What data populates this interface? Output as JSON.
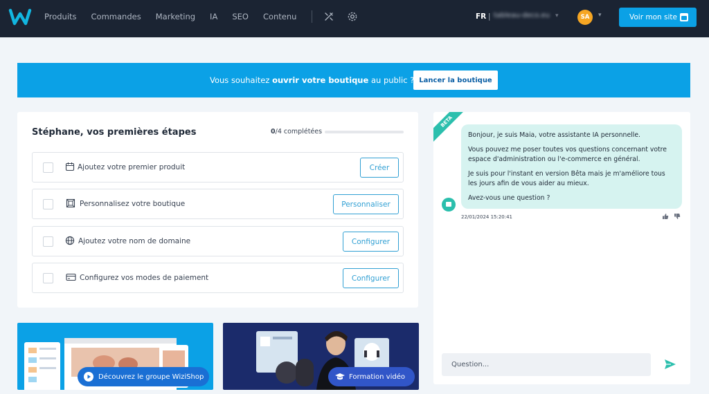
{
  "header": {
    "nav": [
      "Produits",
      "Commandes",
      "Marketing",
      "IA",
      "SEO",
      "Contenu"
    ],
    "tools_icon": "tools-icon",
    "settings_icon": "gear-icon",
    "language": "FR",
    "site_name": "tableau-deco.eu",
    "avatar_initials": "SA",
    "visit_button": "Voir mon site"
  },
  "banner": {
    "text_before": "Vous souhaitez ",
    "text_bold": "ouvrir votre boutique",
    "text_after": " au public ?",
    "button": "Lancer la boutique"
  },
  "steps": {
    "title": "Stéphane, vos premières étapes",
    "completed": "0",
    "total_label": "/4 complétées",
    "progress_fraction": 0,
    "items": [
      {
        "label": "Ajoutez votre premier produit",
        "button": "Créer",
        "icon": "calendar-box-icon"
      },
      {
        "label": "Personnalisez votre boutique",
        "button": "Personnaliser",
        "icon": "image-frame-icon"
      },
      {
        "label": "Ajoutez votre nom de domaine",
        "button": "Configurer",
        "icon": "globe-icon"
      },
      {
        "label": "Configurez vos modes de paiement",
        "button": "Configurer",
        "icon": "credit-card-icon"
      }
    ]
  },
  "chat": {
    "badge": "BETA",
    "messages": [
      "Bonjour, je suis Maia, votre assistante IA personnelle.",
      "Vous pouvez me poser toutes vos questions concernant votre espace d'administration ou l'e-commerce en général.",
      "Je suis pour l'instant en version Bêta mais je m'améliore tous les jours afin de vous aider au mieux.",
      "Avez-vous une question ?"
    ],
    "timestamp": "22/01/2024 15:20:41",
    "input_placeholder": "Question..."
  },
  "promos": {
    "left_label": "Découvrez le groupe WiziShop",
    "right_label": "Formation vidéo"
  },
  "colors": {
    "header_bg": "#1b2433",
    "accent": "#0ba1e6",
    "chat_bubble": "#d6f3f0",
    "teal": "#2bbfad"
  }
}
